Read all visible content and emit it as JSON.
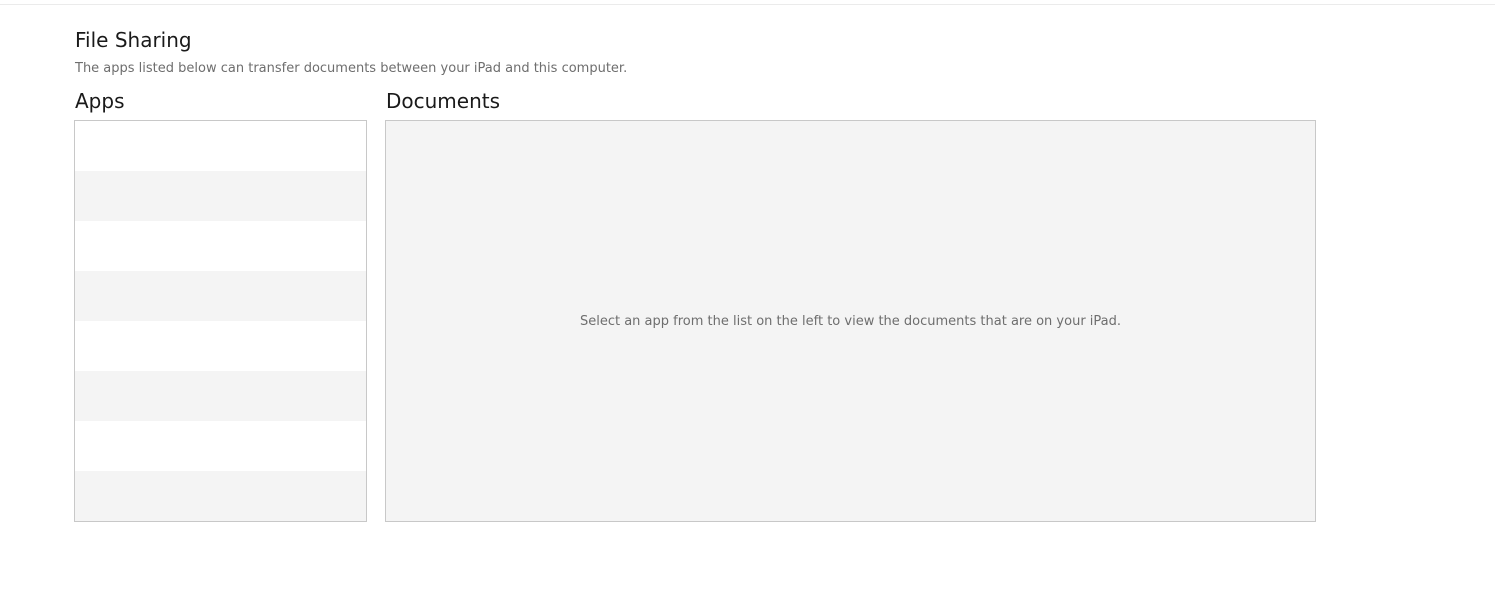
{
  "header": {
    "title": "File Sharing",
    "subtitle": "The apps listed below can transfer documents between your iPad and this computer."
  },
  "apps": {
    "heading": "Apps",
    "row_count": 8
  },
  "documents": {
    "heading": "Documents",
    "empty_message": "Select an app from the list on the left to view the documents that are on your iPad."
  },
  "colors": {
    "row_alt": "#f4f4f4",
    "row_base": "#ffffff",
    "panel_bg": "#f4f4f4",
    "border": "#c8c8c8",
    "muted_text": "#6e6e6e"
  }
}
